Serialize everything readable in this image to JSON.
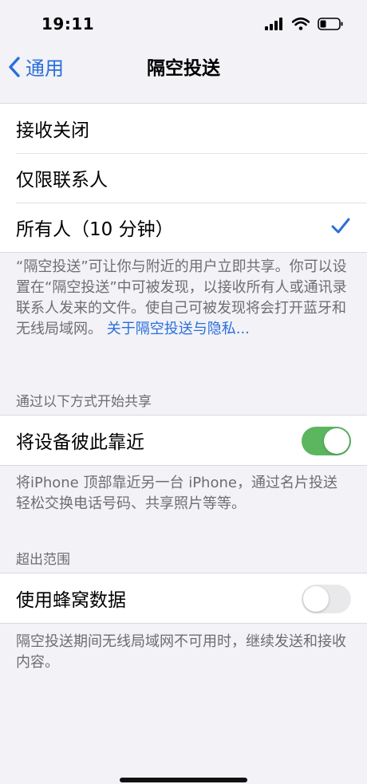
{
  "status": {
    "time": "19:11"
  },
  "nav": {
    "back_label": "通用",
    "title": "隔空投送"
  },
  "receive_options": [
    {
      "label": "接收关闭",
      "checked": false
    },
    {
      "label": "仅限联系人",
      "checked": false
    },
    {
      "label": "所有人（10 分钟）",
      "checked": true
    }
  ],
  "airdrop_note": {
    "text": "“隔空投送”可让你与附近的用户立即共享。你可以设置在“隔空投送”中可被发现，以接收所有人或通讯录联系人发来的文件。使自己可被发现将会打开蓝牙和无线局域网。",
    "link": "关于隔空投送与隐私..."
  },
  "start_sharing": {
    "header": "通过以下方式开始共享",
    "toggle_label": "将设备彼此靠近",
    "toggle_on": true,
    "note": "将iPhone 顶部靠近另一台 iPhone，通过名片投送轻松交换电话号码、共享照片等等。"
  },
  "out_of_range": {
    "header": "超出范围",
    "toggle_label": "使用蜂窝数据",
    "toggle_on": false,
    "note": "隔空投送期间无线局域网不可用时，继续发送和接收内容。"
  },
  "colors": {
    "accent": "#2a6fdb",
    "toggle_on": "#5bb65f",
    "background": "#f2f2f7"
  }
}
